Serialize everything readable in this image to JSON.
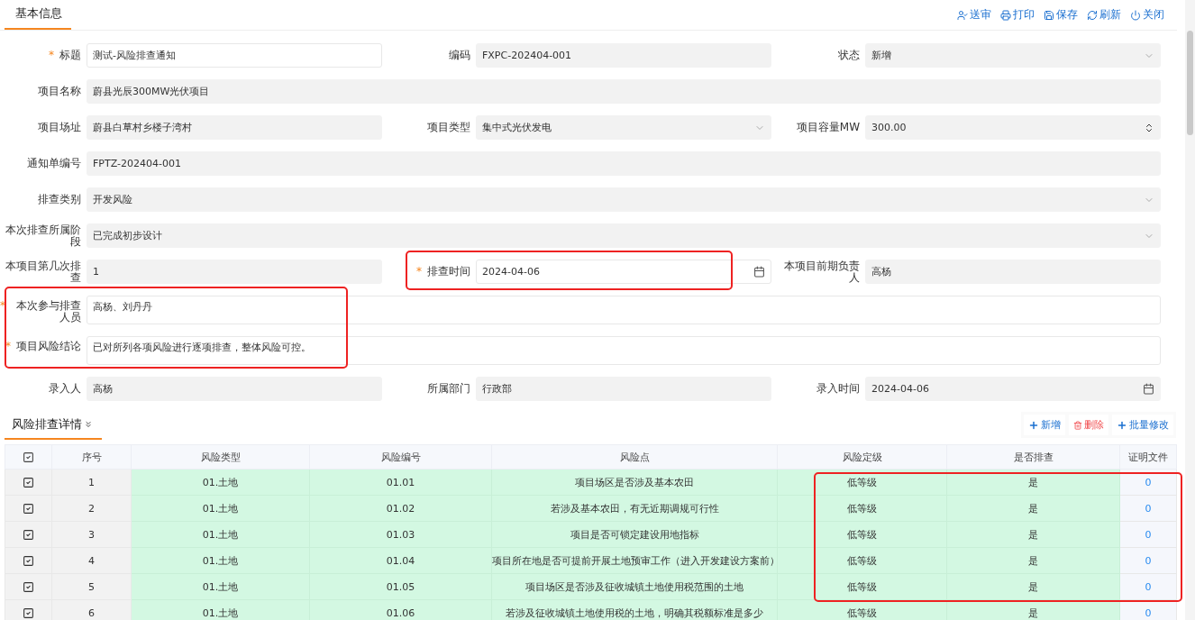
{
  "header": {
    "tabs": [
      {
        "label": "基本信息",
        "selected": true
      }
    ],
    "actions": [
      {
        "kind": "submit",
        "label": "送审"
      },
      {
        "kind": "print",
        "label": "打印"
      },
      {
        "kind": "save",
        "label": "保存"
      },
      {
        "kind": "refresh",
        "label": "刷新"
      },
      {
        "kind": "close",
        "label": "关闭"
      }
    ]
  },
  "form": {
    "fields": [
      {
        "label": "标题",
        "value": "测试-风险排查通知",
        "required_mark": "*",
        "kind": "text",
        "editable": true,
        "wide": false
      },
      {
        "label": "编码",
        "value": "FXPC-202404-001",
        "kind": "text",
        "editable": false,
        "wide": false
      },
      {
        "label": "状态",
        "value": "新增",
        "kind": "select",
        "editable": false,
        "wide": false
      },
      {
        "label": "项目名称",
        "value": "蔚县光辰300MW光伏项目",
        "kind": "text",
        "editable": false,
        "wide": true
      },
      {
        "label": "项目场址",
        "value": "蔚县白草村乡楼子湾村",
        "kind": "text",
        "editable": false,
        "wide": false
      },
      {
        "label": "项目类型",
        "value": "集中式光伏发电",
        "kind": "select",
        "editable": false,
        "wide": false
      },
      {
        "label": "项目容量MW",
        "value": "300.00",
        "kind": "number",
        "editable": false,
        "wide": false
      },
      {
        "label": "通知单编号",
        "value": "FPTZ-202404-001",
        "kind": "text",
        "editable": false,
        "wide": true
      },
      {
        "label": "排查类别",
        "value": "开发风险",
        "kind": "select",
        "editable": false,
        "wide": true
      },
      {
        "label": "本次排查所属阶段",
        "value": "已完成初步设计",
        "kind": "select",
        "editable": false,
        "wide": true
      },
      {
        "label": "本项目第几次排查",
        "value": "1",
        "kind": "text",
        "editable": false,
        "wide": false
      },
      {
        "label": "排查时间",
        "value": "2024-04-06",
        "required_mark": "*",
        "kind": "date",
        "editable": true,
        "wide": false
      },
      {
        "label": "本项目前期负责人",
        "value": "高杨",
        "kind": "text",
        "editable": false,
        "wide": false
      },
      {
        "label": "本次参与排查人员",
        "value": "高杨、刘丹丹",
        "required_mark": "*",
        "kind": "textarea",
        "editable": true,
        "wide": true
      },
      {
        "label": "项目风险结论",
        "value": "已对所列各项风险进行逐项排查，整体风险可控。",
        "required_mark": "*",
        "kind": "textarea",
        "editable": true,
        "wide": true
      },
      {
        "label": "录入人",
        "value": "高杨",
        "kind": "text",
        "editable": false,
        "wide": false
      },
      {
        "label": "所属部门",
        "value": "行政部",
        "kind": "text",
        "editable": false,
        "wide": false
      },
      {
        "label": "录入时间",
        "value": "2024-04-06",
        "kind": "date",
        "editable": false,
        "wide": false
      }
    ]
  },
  "detail": {
    "tab": {
      "label": "风险排查详情",
      "selected": true
    },
    "actions": [
      {
        "kind": "add",
        "label": "新增"
      },
      {
        "kind": "delete",
        "label": "删除"
      },
      {
        "kind": "add",
        "label": "批量修改"
      }
    ],
    "table": {
      "all_checked": true,
      "columns": [
        "序号",
        "风险类型",
        "风险编号",
        "风险点",
        "风险定级",
        "是否排查",
        "证明文件"
      ],
      "rows": [
        {
          "checked": true,
          "cells": [
            "1",
            "01.土地",
            "01.01",
            "项目场区是否涉及基本农田",
            "低等级",
            "是",
            "0"
          ]
        },
        {
          "checked": true,
          "cells": [
            "2",
            "01.土地",
            "01.02",
            "若涉及基本农田，有无近期调规可行性",
            "低等级",
            "是",
            "0"
          ]
        },
        {
          "checked": true,
          "cells": [
            "3",
            "01.土地",
            "01.03",
            "项目是否可锁定建设用地指标",
            "低等级",
            "是",
            "0"
          ]
        },
        {
          "checked": true,
          "cells": [
            "4",
            "01.土地",
            "01.04",
            "项目所在地是否可提前开展土地预审工作（进入开发建设方案前）",
            "低等级",
            "是",
            "0"
          ]
        },
        {
          "checked": true,
          "cells": [
            "5",
            "01.土地",
            "01.05",
            "项目场区是否涉及征收城镇土地使用税范围的土地",
            "低等级",
            "是",
            "0"
          ]
        },
        {
          "checked": true,
          "cells": [
            "6",
            "01.土地",
            "01.06",
            "若涉及征收城镇土地使用税的土地，明确其税额标准是多少",
            "低等级",
            "是",
            "0"
          ]
        }
      ]
    }
  }
}
